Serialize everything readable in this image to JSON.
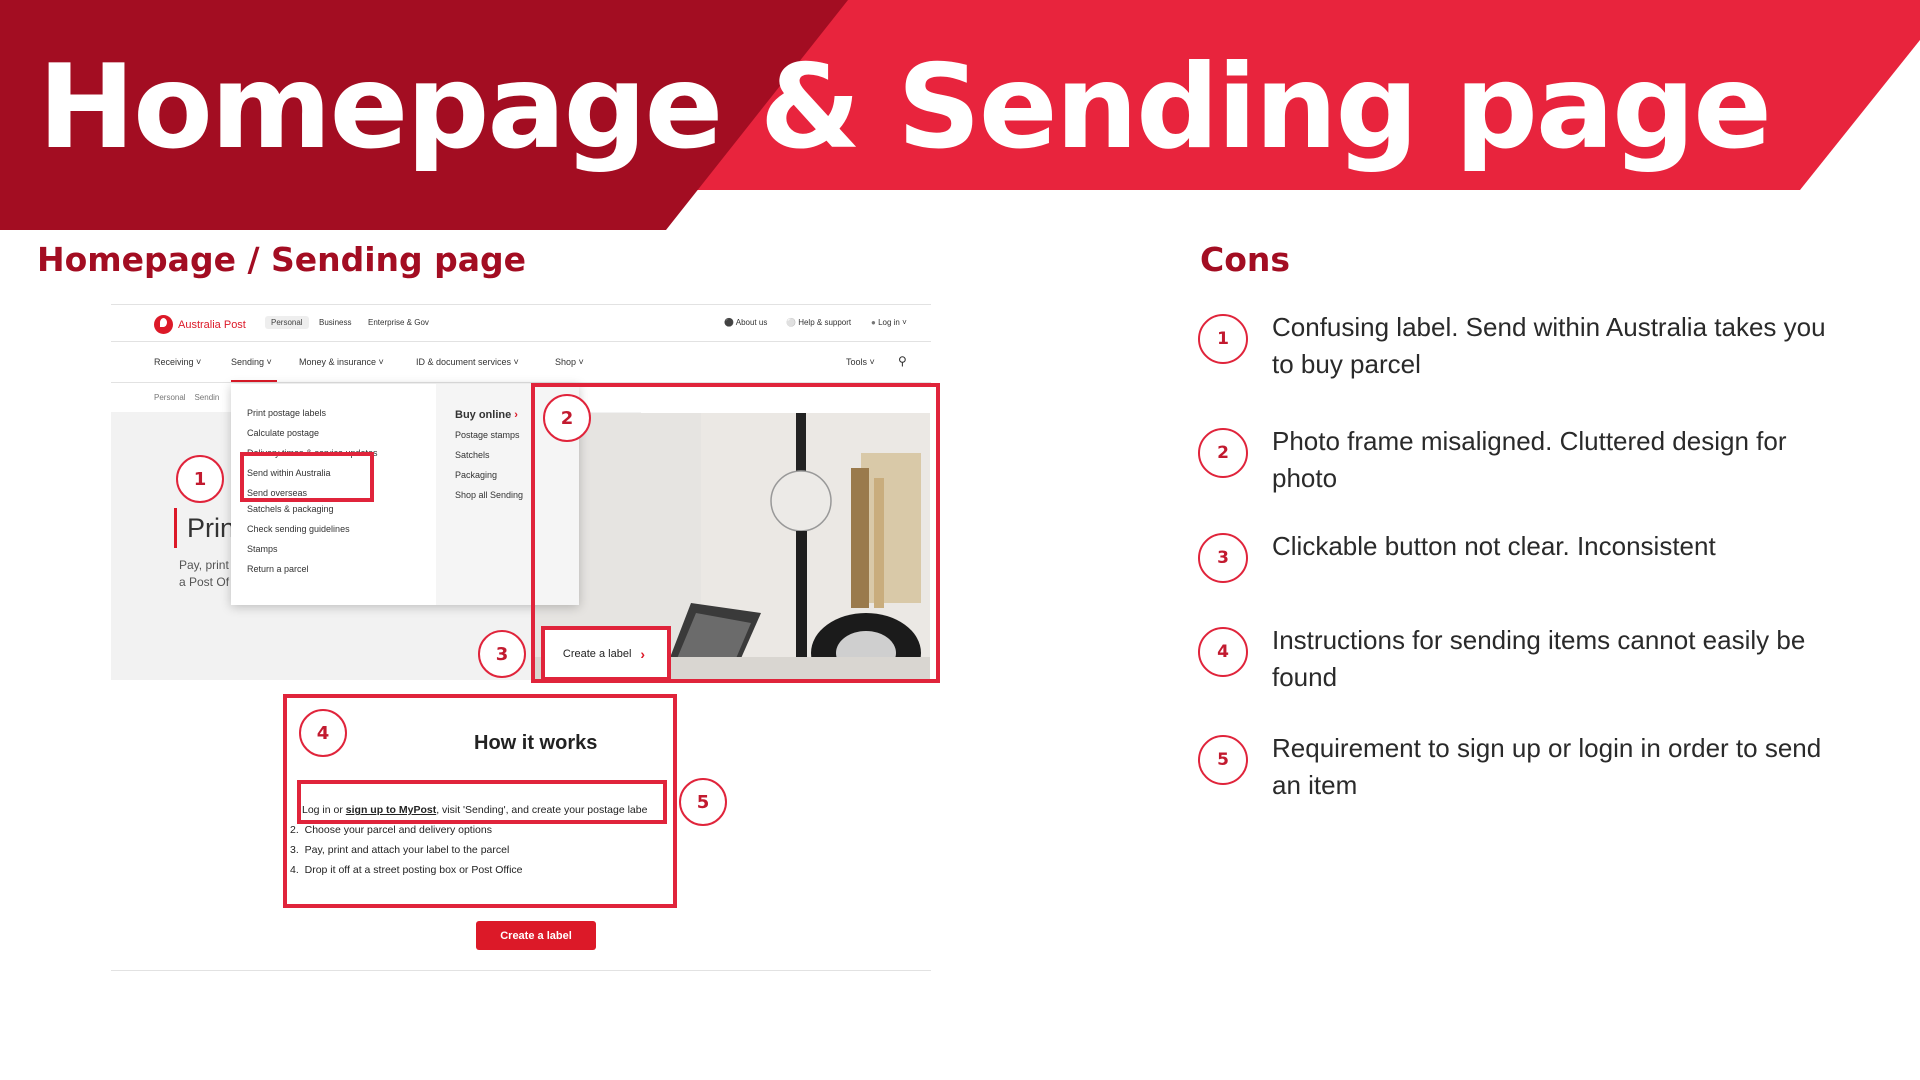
{
  "colors": {
    "banner_dark": "#a30d22",
    "banner_bright": "#e8243d",
    "accent": "#dc1928",
    "annotation": "#e0243b"
  },
  "slide": {
    "title": "Homepage & Sending page",
    "subtitle": "Homepage / Sending page",
    "cons_heading": "Cons"
  },
  "site": {
    "logo_text": "Australia Post",
    "audience_tabs": [
      "Personal",
      "Business",
      "Enterprise & Gov"
    ],
    "utility": {
      "about": "About us",
      "help": "Help & support",
      "login": "Log in"
    },
    "nav": [
      "Receiving",
      "Sending",
      "Money & insurance",
      "ID & document services",
      "Shop"
    ],
    "tools": "Tools",
    "breadcrumb": [
      "Personal",
      "Sendin"
    ],
    "hero_title": "Print",
    "hero_text": [
      "Pay, print",
      "a Post Of"
    ],
    "menu_left": [
      "Print postage labels",
      "Calculate postage",
      "Delivery times & service updates",
      "Send within Australia",
      "Send overseas",
      "Satchels & packaging",
      "Check sending guidelines",
      "Stamps",
      "Return a parcel"
    ],
    "menu_right_title": "Buy online",
    "menu_right": [
      "Postage stamps",
      "Satchels",
      "Packaging",
      "Shop all Sending"
    ],
    "create_label_small": "Create a label",
    "how_title": "How it works",
    "steps": {
      "s1_pre": "Log in or ",
      "s1_link": "sign up to MyPost",
      "s1_post": ", visit 'Sending', and create your postage labe",
      "s2": "Choose your parcel and delivery options",
      "s3": "Pay, print and attach your label to the parcel",
      "s4": "Drop it off at a street posting box or Post Office",
      "n2": "2.",
      "n3": "3.",
      "n4": "4."
    },
    "create_label_button": "Create a label"
  },
  "annotations": [
    "1",
    "2",
    "3",
    "4",
    "5"
  ],
  "cons": [
    {
      "num": "1",
      "text": "Confusing label. Send within Australia takes you to buy parcel"
    },
    {
      "num": "2",
      "text": "Photo frame misaligned. Cluttered design for photo"
    },
    {
      "num": "3",
      "text": "Clickable button not clear. Inconsistent"
    },
    {
      "num": "4",
      "text": "Instructions for sending items cannot easily be found"
    },
    {
      "num": "5",
      "text": "Requirement to sign up or login in order to send an item"
    }
  ]
}
